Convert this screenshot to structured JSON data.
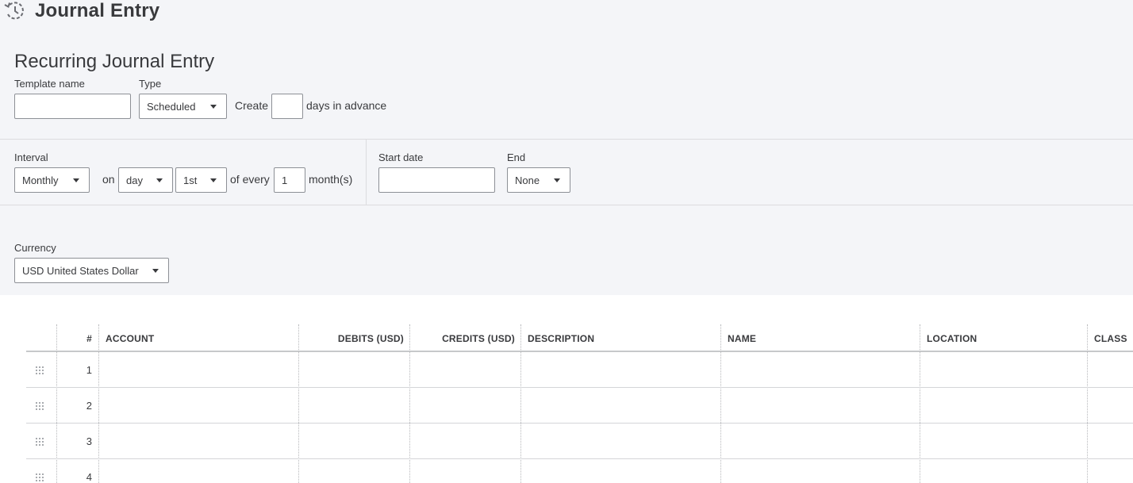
{
  "header": {
    "title": "Journal Entry",
    "icon": "recurring-clock-icon"
  },
  "subtitle": "Recurring Journal Entry",
  "template": {
    "name_label": "Template name",
    "name_value": ""
  },
  "type": {
    "label": "Type",
    "value": "Scheduled"
  },
  "create": {
    "label": "Create",
    "days_value": "",
    "suffix": "days in advance"
  },
  "interval": {
    "label": "Interval",
    "frequency": "Monthly",
    "on_label": "on",
    "day_type": "day",
    "day_value": "1st",
    "of_every_label": "of every",
    "every_value": "1",
    "unit_label": "month(s)"
  },
  "start_date": {
    "label": "Start date",
    "value": ""
  },
  "end": {
    "label": "End",
    "value": "None"
  },
  "currency": {
    "label": "Currency",
    "value": "USD United States Dollar"
  },
  "table": {
    "columns": [
      "#",
      "ACCOUNT",
      "DEBITS (USD)",
      "CREDITS (USD)",
      "DESCRIPTION",
      "NAME",
      "LOCATION",
      "CLASS"
    ],
    "rows": [
      {
        "num": "1"
      },
      {
        "num": "2"
      },
      {
        "num": "3"
      },
      {
        "num": "4"
      }
    ]
  }
}
